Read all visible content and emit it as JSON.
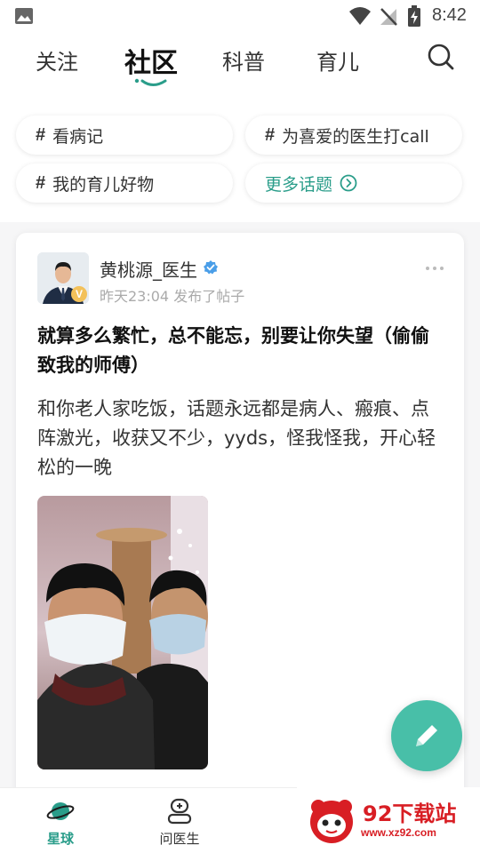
{
  "status_bar": {
    "time": "8:42",
    "icons": [
      "image-icon",
      "wifi-icon",
      "no-signal-icon",
      "battery-charging-icon"
    ]
  },
  "top_tabs": [
    {
      "label": "关注",
      "active": false
    },
    {
      "label": "社区",
      "active": true
    },
    {
      "label": "科普",
      "active": false
    },
    {
      "label": "育儿",
      "active": false
    }
  ],
  "accent_color": "#2a9d8a",
  "topics": [
    {
      "label": "看病记"
    },
    {
      "label": "为喜爱的医生打call"
    },
    {
      "label": "我的育儿好物"
    }
  ],
  "more_topics": {
    "label": "更多话题"
  },
  "post": {
    "author": "黄桃源_医生",
    "meta": "昨天23:04 发布了帖子",
    "avatar_badge": "V",
    "title": "就算多么繁忙，总不能忘，别要让你失望（偷偷致我的师傅）",
    "body": "和你老人家吃饭，话题永远都是病人、瘢痕、点阵激光，收获又不少，yyds，怪我怪我，开心轻松的一晚"
  },
  "bottom_nav": [
    {
      "label": "星球",
      "icon": "planet-icon",
      "active": true
    },
    {
      "label": "问医生",
      "icon": "doctor-icon",
      "active": false
    }
  ],
  "watermark": {
    "title": "92下载站",
    "url": "www.xz92.com"
  }
}
